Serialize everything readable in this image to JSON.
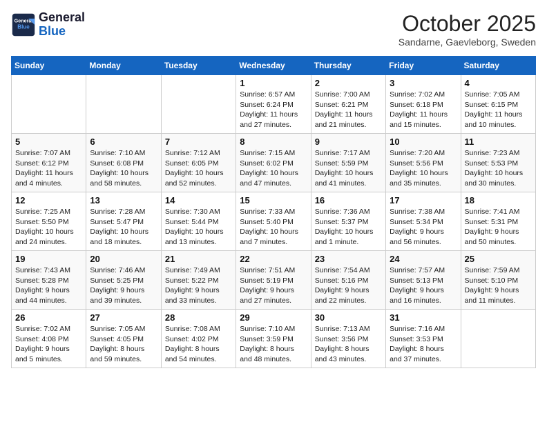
{
  "header": {
    "logo_line1": "General",
    "logo_line2": "Blue",
    "month": "October 2025",
    "location": "Sandarne, Gaevleborg, Sweden"
  },
  "weekdays": [
    "Sunday",
    "Monday",
    "Tuesday",
    "Wednesday",
    "Thursday",
    "Friday",
    "Saturday"
  ],
  "weeks": [
    [
      {
        "day": "",
        "info": ""
      },
      {
        "day": "",
        "info": ""
      },
      {
        "day": "",
        "info": ""
      },
      {
        "day": "1",
        "info": "Sunrise: 6:57 AM\nSunset: 6:24 PM\nDaylight: 11 hours\nand 27 minutes."
      },
      {
        "day": "2",
        "info": "Sunrise: 7:00 AM\nSunset: 6:21 PM\nDaylight: 11 hours\nand 21 minutes."
      },
      {
        "day": "3",
        "info": "Sunrise: 7:02 AM\nSunset: 6:18 PM\nDaylight: 11 hours\nand 15 minutes."
      },
      {
        "day": "4",
        "info": "Sunrise: 7:05 AM\nSunset: 6:15 PM\nDaylight: 11 hours\nand 10 minutes."
      }
    ],
    [
      {
        "day": "5",
        "info": "Sunrise: 7:07 AM\nSunset: 6:12 PM\nDaylight: 11 hours\nand 4 minutes."
      },
      {
        "day": "6",
        "info": "Sunrise: 7:10 AM\nSunset: 6:08 PM\nDaylight: 10 hours\nand 58 minutes."
      },
      {
        "day": "7",
        "info": "Sunrise: 7:12 AM\nSunset: 6:05 PM\nDaylight: 10 hours\nand 52 minutes."
      },
      {
        "day": "8",
        "info": "Sunrise: 7:15 AM\nSunset: 6:02 PM\nDaylight: 10 hours\nand 47 minutes."
      },
      {
        "day": "9",
        "info": "Sunrise: 7:17 AM\nSunset: 5:59 PM\nDaylight: 10 hours\nand 41 minutes."
      },
      {
        "day": "10",
        "info": "Sunrise: 7:20 AM\nSunset: 5:56 PM\nDaylight: 10 hours\nand 35 minutes."
      },
      {
        "day": "11",
        "info": "Sunrise: 7:23 AM\nSunset: 5:53 PM\nDaylight: 10 hours\nand 30 minutes."
      }
    ],
    [
      {
        "day": "12",
        "info": "Sunrise: 7:25 AM\nSunset: 5:50 PM\nDaylight: 10 hours\nand 24 minutes."
      },
      {
        "day": "13",
        "info": "Sunrise: 7:28 AM\nSunset: 5:47 PM\nDaylight: 10 hours\nand 18 minutes."
      },
      {
        "day": "14",
        "info": "Sunrise: 7:30 AM\nSunset: 5:44 PM\nDaylight: 10 hours\nand 13 minutes."
      },
      {
        "day": "15",
        "info": "Sunrise: 7:33 AM\nSunset: 5:40 PM\nDaylight: 10 hours\nand 7 minutes."
      },
      {
        "day": "16",
        "info": "Sunrise: 7:36 AM\nSunset: 5:37 PM\nDaylight: 10 hours\nand 1 minute."
      },
      {
        "day": "17",
        "info": "Sunrise: 7:38 AM\nSunset: 5:34 PM\nDaylight: 9 hours\nand 56 minutes."
      },
      {
        "day": "18",
        "info": "Sunrise: 7:41 AM\nSunset: 5:31 PM\nDaylight: 9 hours\nand 50 minutes."
      }
    ],
    [
      {
        "day": "19",
        "info": "Sunrise: 7:43 AM\nSunset: 5:28 PM\nDaylight: 9 hours\nand 44 minutes."
      },
      {
        "day": "20",
        "info": "Sunrise: 7:46 AM\nSunset: 5:25 PM\nDaylight: 9 hours\nand 39 minutes."
      },
      {
        "day": "21",
        "info": "Sunrise: 7:49 AM\nSunset: 5:22 PM\nDaylight: 9 hours\nand 33 minutes."
      },
      {
        "day": "22",
        "info": "Sunrise: 7:51 AM\nSunset: 5:19 PM\nDaylight: 9 hours\nand 27 minutes."
      },
      {
        "day": "23",
        "info": "Sunrise: 7:54 AM\nSunset: 5:16 PM\nDaylight: 9 hours\nand 22 minutes."
      },
      {
        "day": "24",
        "info": "Sunrise: 7:57 AM\nSunset: 5:13 PM\nDaylight: 9 hours\nand 16 minutes."
      },
      {
        "day": "25",
        "info": "Sunrise: 7:59 AM\nSunset: 5:10 PM\nDaylight: 9 hours\nand 11 minutes."
      }
    ],
    [
      {
        "day": "26",
        "info": "Sunrise: 7:02 AM\nSunset: 4:08 PM\nDaylight: 9 hours\nand 5 minutes."
      },
      {
        "day": "27",
        "info": "Sunrise: 7:05 AM\nSunset: 4:05 PM\nDaylight: 8 hours\nand 59 minutes."
      },
      {
        "day": "28",
        "info": "Sunrise: 7:08 AM\nSunset: 4:02 PM\nDaylight: 8 hours\nand 54 minutes."
      },
      {
        "day": "29",
        "info": "Sunrise: 7:10 AM\nSunset: 3:59 PM\nDaylight: 8 hours\nand 48 minutes."
      },
      {
        "day": "30",
        "info": "Sunrise: 7:13 AM\nSunset: 3:56 PM\nDaylight: 8 hours\nand 43 minutes."
      },
      {
        "day": "31",
        "info": "Sunrise: 7:16 AM\nSunset: 3:53 PM\nDaylight: 8 hours\nand 37 minutes."
      },
      {
        "day": "",
        "info": ""
      }
    ]
  ]
}
